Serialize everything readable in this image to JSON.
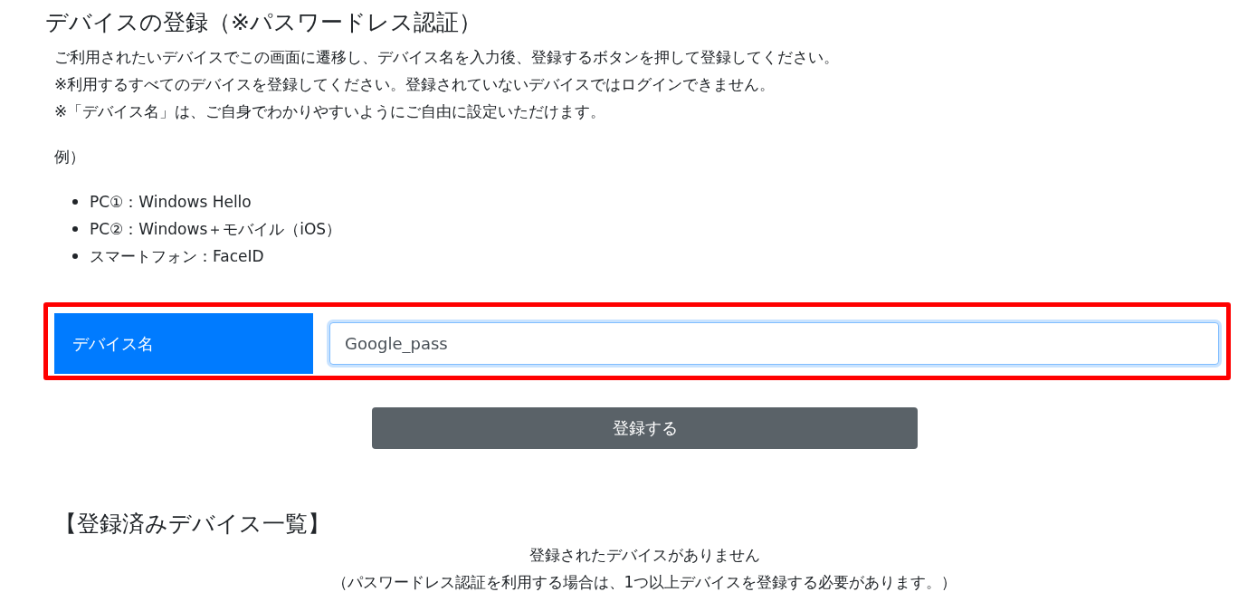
{
  "title": "デバイスの登録（※パスワードレス認証）",
  "instructions": [
    "ご利用されたいデバイスでこの画面に遷移し、デバイス名を入力後、登録するボタンを押して登録してください。",
    "※利用するすべてのデバイスを登録してください。登録されていないデバイスではログインできません。",
    "※「デバイス名」は、ご自身でわかりやすいようにご自由に設定いただけます。"
  ],
  "example_label": "例）",
  "examples": [
    "PC①：Windows Hello",
    "PC②：Windows＋モバイル（iOS）",
    "スマートフォン：FaceID"
  ],
  "device_form": {
    "label": "デバイス名",
    "value": "Google_pass",
    "highlighted": true
  },
  "register_button": "登録する",
  "registered_heading": "【登録済みデバイス一覧】",
  "empty_messages": [
    "登録されたデバイスがありません",
    "（パスワードレス認証を利用する場合は、1つ以上デバイスを登録する必要があります。）"
  ]
}
